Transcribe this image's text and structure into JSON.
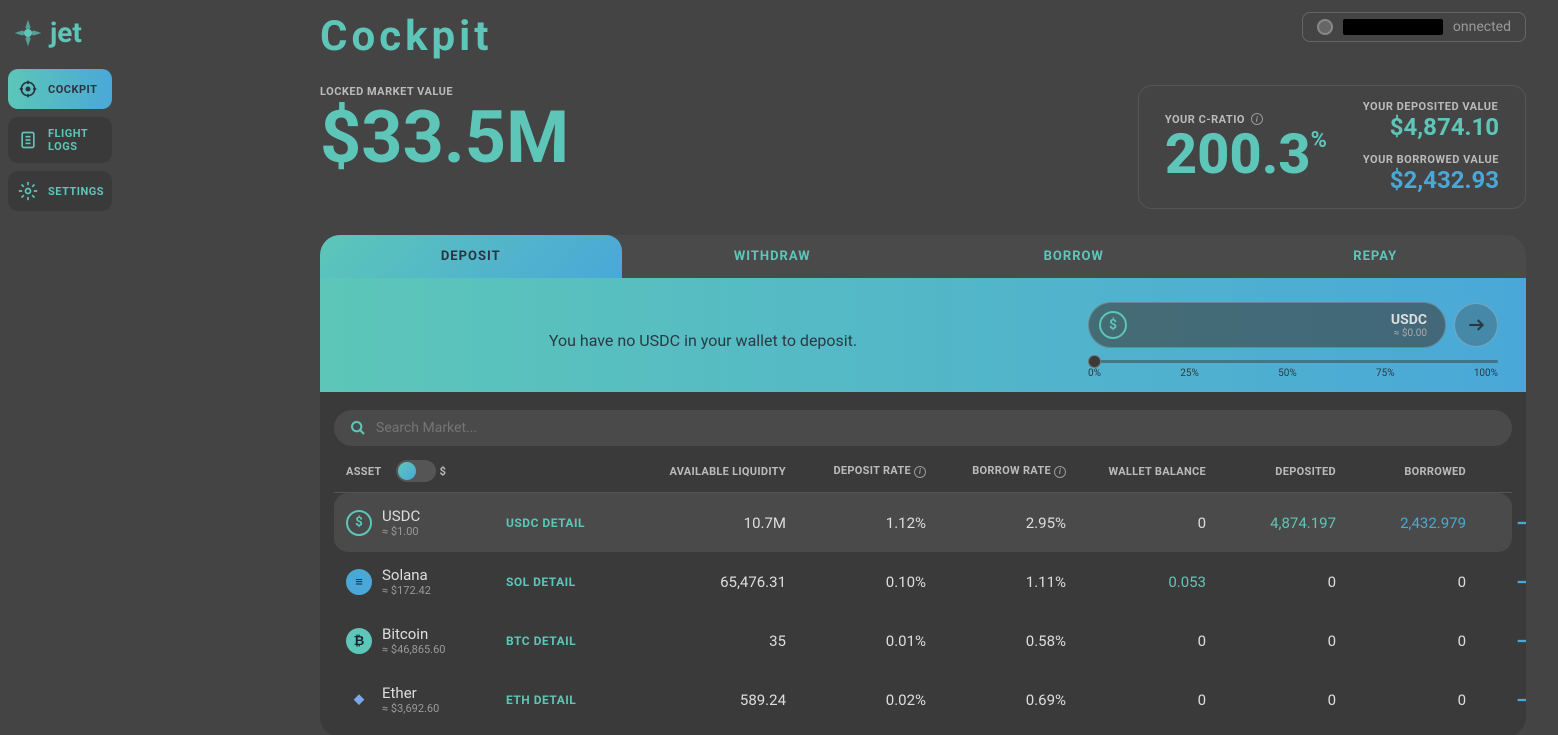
{
  "brand": "jet",
  "nav": {
    "cockpit": "COCKPIT",
    "flightlogs": "FLIGHT LOGS",
    "settings": "SETTINGS"
  },
  "page_title": "Cockpit",
  "wallet_status": "onnected",
  "stats": {
    "locked_label": "LOCKED MARKET VALUE",
    "locked_value": "$33.5M",
    "cratio_label": "YOUR C-RATIO",
    "cratio_value": "200.3",
    "cratio_pct": "%",
    "deposited_label": "YOUR DEPOSITED VALUE",
    "deposited_value": "$4,874.10",
    "borrowed_label": "YOUR BORROWED VALUE",
    "borrowed_value": "$2,432.93"
  },
  "tabs": {
    "deposit": "DEPOSIT",
    "withdraw": "WITHDRAW",
    "borrow": "BORROW",
    "repay": "REPAY"
  },
  "deposit": {
    "message": "You have no USDC in your wallet to deposit.",
    "symbol": "USDC",
    "approx": "≈ $0.00",
    "slider": {
      "p0": "0%",
      "p25": "25%",
      "p50": "50%",
      "p75": "75%",
      "p100": "100%"
    }
  },
  "search_placeholder": "Search Market...",
  "columns": {
    "asset": "ASSET",
    "dollar": "$",
    "liquidity": "AVAILABLE LIQUIDITY",
    "deposit_rate": "DEPOSIT RATE",
    "borrow_rate": "BORROW RATE",
    "wallet": "WALLET BALANCE",
    "deposited": "DEPOSITED",
    "borrowed": "BORROWED"
  },
  "rows": [
    {
      "name": "USDC",
      "price": "≈ $1.00",
      "detail": "USDC DETAIL",
      "liquidity": "10.7M",
      "deposit_rate": "1.12%",
      "borrow_rate": "2.95%",
      "wallet": "0",
      "deposited": "4,874.197",
      "borrowed": "2,432.979",
      "icon_bg": "transparent",
      "icon_border": "#5dc6b8",
      "icon_color": "#5dc6b8",
      "icon_text": "$",
      "active": true,
      "wallet_teal": false,
      "dep_teal": true,
      "bor_blue": true
    },
    {
      "name": "Solana",
      "price": "≈ $172.42",
      "detail": "SOL DETAIL",
      "liquidity": "65,476.31",
      "deposit_rate": "0.10%",
      "borrow_rate": "1.11%",
      "wallet": "0.053",
      "deposited": "0",
      "borrowed": "0",
      "icon_bg": "#4aa8d8",
      "icon_border": "#4aa8d8",
      "icon_color": "#1a2530",
      "icon_text": "≡",
      "active": false,
      "wallet_teal": true,
      "dep_teal": false,
      "bor_blue": false
    },
    {
      "name": "Bitcoin",
      "price": "≈ $46,865.60",
      "detail": "BTC DETAIL",
      "liquidity": "35",
      "deposit_rate": "0.01%",
      "borrow_rate": "0.58%",
      "wallet": "0",
      "deposited": "0",
      "borrowed": "0",
      "icon_bg": "#5dc6b8",
      "icon_border": "#5dc6b8",
      "icon_color": "#1a2530",
      "icon_text": "₿",
      "active": false,
      "wallet_teal": false,
      "dep_teal": false,
      "bor_blue": false
    },
    {
      "name": "Ether",
      "price": "≈ $3,692.60",
      "detail": "ETH DETAIL",
      "liquidity": "589.24",
      "deposit_rate": "0.02%",
      "borrow_rate": "0.69%",
      "wallet": "0",
      "deposited": "0",
      "borrowed": "0",
      "icon_bg": "transparent",
      "icon_border": "transparent",
      "icon_color": "#7aa8e8",
      "icon_text": "◆",
      "active": false,
      "wallet_teal": false,
      "dep_teal": false,
      "bor_blue": false
    }
  ]
}
